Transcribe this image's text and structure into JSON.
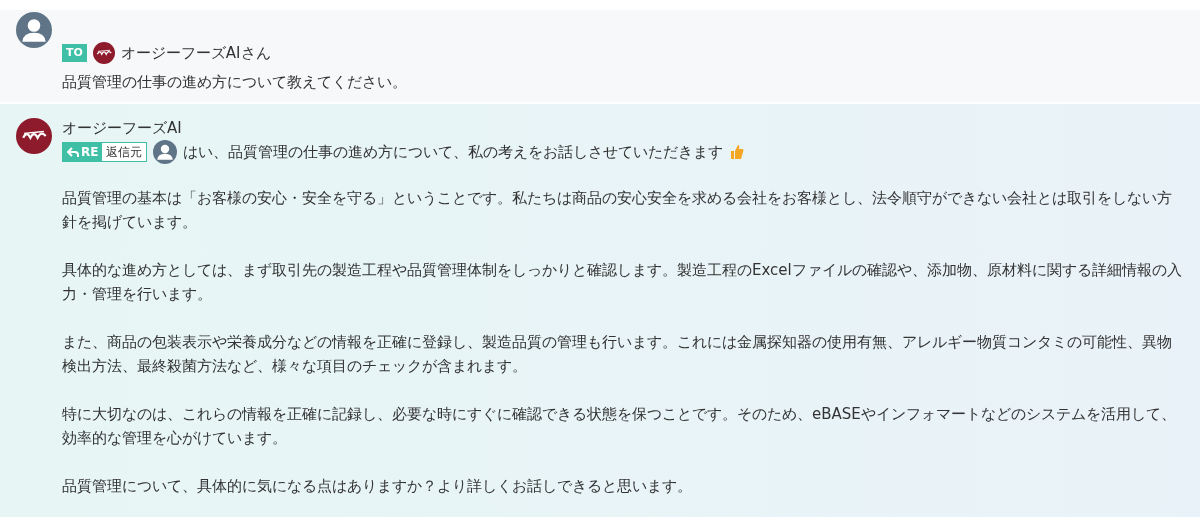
{
  "user_message": {
    "to_badge": "TO",
    "recipient": "オージーフーズAIさん",
    "text": "品質管理の仕事の進め方について教えてください。"
  },
  "ai_message": {
    "sender": "オージーフーズAI",
    "reply_badge": "RE",
    "reply_source": "返信元",
    "first_line": "はい、品質管理の仕事の進め方について、私の考えをお話しさせていただきます",
    "paragraphs": [
      "品質管理の基本は「お客様の安心・安全を守る」ということです。私たちは商品の安心安全を求める会社をお客様とし、法令順守ができない会社とは取引をしない方針を掲げています。",
      "具体的な進め方としては、まず取引先の製造工程や品質管理体制をしっかりと確認します。製造工程のExcelファイルの確認や、添加物、原材料に関する詳細情報の入力・管理を行います。",
      "また、商品の包装表示や栄養成分などの情報を正確に登録し、製造品質の管理も行います。これには金属探知器の使用有無、アレルギー物質コンタミの可能性、異物検出方法、最終殺菌方法など、様々な項目のチェックが含まれます。",
      "特に大切なのは、これらの情報を正確に記録し、必要な時にすぐに確認できる状態を保つことです。そのため、eBASEやインフォマートなどのシステムを活用して、効率的な管理を心がけています。",
      "品質管理について、具体的に気になる点はありますか？より詳しくお話しできると思います。"
    ]
  }
}
